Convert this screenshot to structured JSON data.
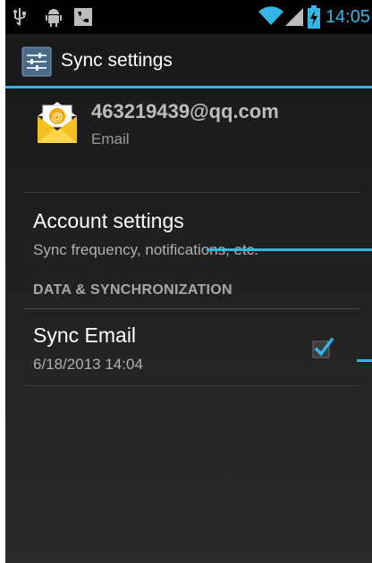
{
  "status_bar": {
    "time": "14:05",
    "icons": [
      "usb-icon",
      "android-debug-icon",
      "phone-call-icon",
      "wifi-icon",
      "signal-icon",
      "battery-charging-icon"
    ]
  },
  "action_bar": {
    "title": "Sync settings",
    "icon": "sync-settings-icon"
  },
  "account": {
    "email": "463219439@qq.com",
    "type": "Email",
    "icon": "email-envelope-icon"
  },
  "settings": {
    "account_settings": {
      "title": "Account settings",
      "summary": "Sync frequency, notifications, etc."
    },
    "section_header": "DATA & SYNCHRONIZATION",
    "sync_email": {
      "title": "Sync Email",
      "summary": "6/18/2013 14:04",
      "checked": true
    }
  },
  "colors": {
    "accent": "#33b5e5",
    "background": "#1b1b1b",
    "status_bar": "#000000"
  }
}
